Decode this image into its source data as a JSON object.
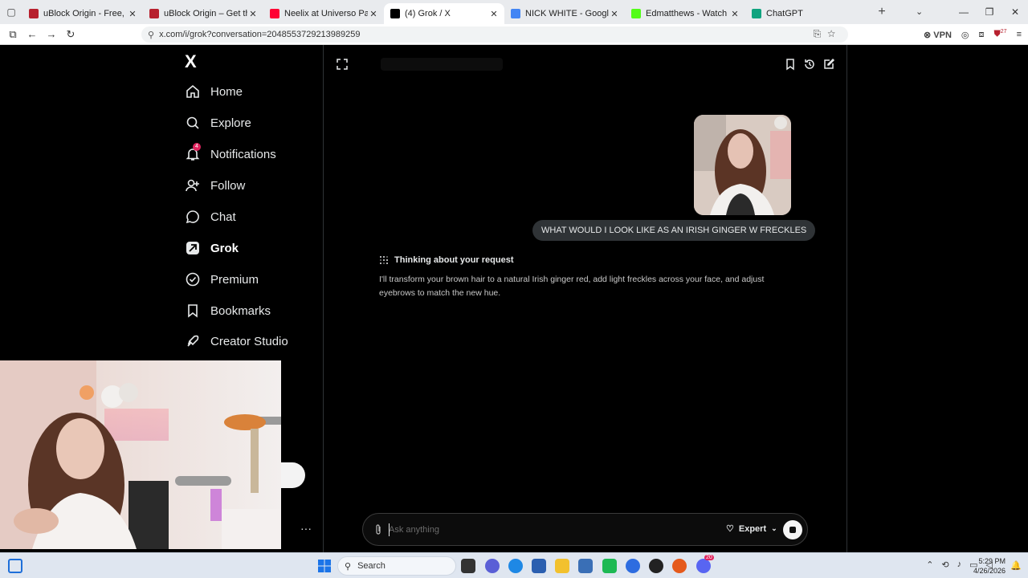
{
  "browser": {
    "tabs": [
      {
        "title": "uBlock Origin - Free, open-sour",
        "color": "#b7202e"
      },
      {
        "title": "uBlock Origin – Get this Extensi",
        "color": "#b7202e"
      },
      {
        "title": "Neelix at Universo Paralello - Yo",
        "color": "#ff0033"
      },
      {
        "title": "(4) Grok / X",
        "color": "#000000"
      },
      {
        "title": "NICK WHITE - Google Search",
        "color": "#4285f4"
      },
      {
        "title": "Edmatthews - Watch clips on Ki",
        "color": "#53fc18"
      },
      {
        "title": "ChatGPT",
        "color": "#10a37f"
      }
    ],
    "url": "x.com/i/grok?conversation=2048553729213989259",
    "vpn_label": "VPN",
    "extension_badge": "27"
  },
  "nav": {
    "logo": "X",
    "notifications_count": "4",
    "items": [
      {
        "label": "Home",
        "icon": "home-icon"
      },
      {
        "label": "Explore",
        "icon": "search-icon"
      },
      {
        "label": "Notifications",
        "icon": "bell-icon"
      },
      {
        "label": "Follow",
        "icon": "person-add-icon"
      },
      {
        "label": "Chat",
        "icon": "chat-bubble-icon"
      },
      {
        "label": "Grok",
        "icon": "grok-icon"
      },
      {
        "label": "Premium",
        "icon": "verified-icon"
      },
      {
        "label": "Bookmarks",
        "icon": "bookmark-icon"
      },
      {
        "label": "Creator Studio",
        "icon": "rocket-icon"
      }
    ],
    "more_label": "···"
  },
  "chat": {
    "user_message": "WHAT WOULD I LOOK LIKE AS AN IRISH GINGER W FRECKLES",
    "thinking_label": "Thinking about your request",
    "response": "I'll transform your brown hair to a natural Irish ginger red, add light freckles across your face, and adjust eyebrows to match the new hue."
  },
  "composer": {
    "placeholder": "Ask anything",
    "mode": "Expert"
  },
  "taskbar": {
    "search_label": "Search",
    "time": "5:29 PM",
    "date": "4/26/2026",
    "discord_badge": "20"
  }
}
